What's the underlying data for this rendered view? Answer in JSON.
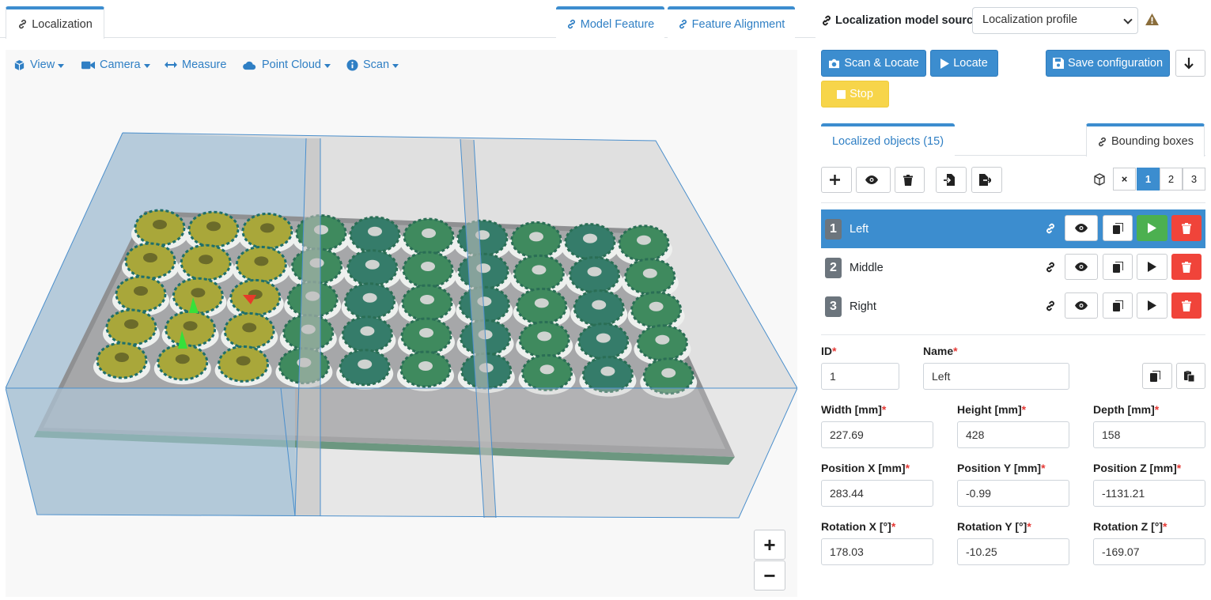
{
  "tabs": {
    "localization": "Localization",
    "model_feature": "Model Feature",
    "feature_alignment": "Feature Alignment"
  },
  "viewer_toolbar": {
    "view": "View",
    "camera": "Camera",
    "measure": "Measure",
    "point_cloud": "Point Cloud",
    "scan": "Scan"
  },
  "zoom": {
    "in": "+",
    "out": "−"
  },
  "model_source": {
    "label": "Localization model source",
    "selected": "Localization profile"
  },
  "actions": {
    "scan_locate": "Scan & Locate",
    "locate": "Locate",
    "save_configuration": "Save configuration",
    "stop": "Stop"
  },
  "subtabs": {
    "localized_objects": "Localized objects (15)",
    "bounding_boxes": "Bounding boxes"
  },
  "pagination": [
    "×",
    "1",
    "2",
    "3"
  ],
  "bounding_boxes": [
    {
      "id": "1",
      "name": "Left",
      "selected": true
    },
    {
      "id": "2",
      "name": "Middle",
      "selected": false
    },
    {
      "id": "3",
      "name": "Right",
      "selected": false
    }
  ],
  "form": {
    "id_label": "ID",
    "id_value": "1",
    "name_label": "Name",
    "name_value": "Left",
    "width_label": "Width [mm]",
    "width_value": "227.69",
    "height_label": "Height [mm]",
    "height_value": "428",
    "depth_label": "Depth [mm]",
    "depth_value": "158",
    "posx_label": "Position X [mm]",
    "posx_value": "283.44",
    "posy_label": "Position Y [mm]",
    "posy_value": "-0.99",
    "posz_label": "Position Z [mm]",
    "posz_value": "-1131.21",
    "rotx_label": "Rotation X [°]",
    "rotx_value": "178.03",
    "roty_label": "Rotation Y [°]",
    "roty_value": "-10.25",
    "rotz_label": "Rotation Z [°]",
    "rotz_value": "-169.07",
    "required_mark": "*"
  },
  "colors": {
    "primary": "#3c8dcf",
    "success": "#4cb050",
    "danger": "#f0443a",
    "warning": "#f7d54a"
  }
}
